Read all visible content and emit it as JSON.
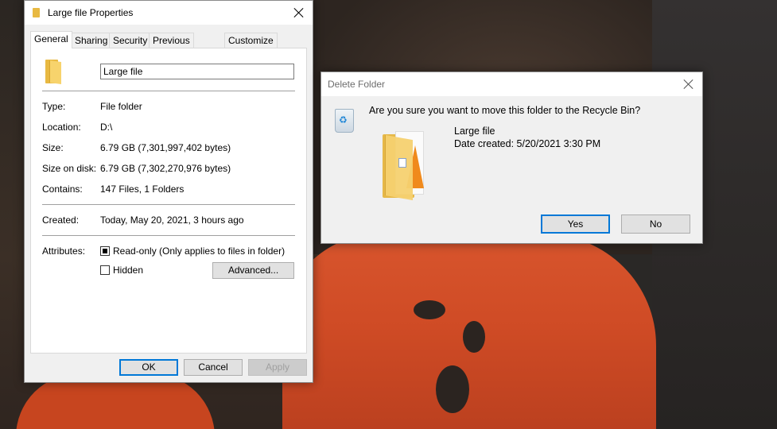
{
  "properties_dialog": {
    "title": "Large file Properties",
    "tabs": [
      {
        "label": "General",
        "active": true
      },
      {
        "label": "Sharing"
      },
      {
        "label": "Security"
      },
      {
        "label": "Previous Versions"
      },
      {
        "label": "Customize"
      }
    ],
    "name_value": "Large file",
    "rows": {
      "type": {
        "label": "Type:",
        "value": "File folder"
      },
      "location": {
        "label": "Location:",
        "value": "D:\\"
      },
      "size": {
        "label": "Size:",
        "value": "6.79 GB (7,301,997,402 bytes)"
      },
      "size_on_disk": {
        "label": "Size on disk:",
        "value": "6.79 GB (7,302,270,976 bytes)"
      },
      "contains": {
        "label": "Contains:",
        "value": "147 Files, 1 Folders"
      },
      "created": {
        "label": "Created:",
        "value": "Today, May 20, 2021, 3 hours ago"
      }
    },
    "attributes": {
      "label": "Attributes:",
      "readonly_label": "Read-only (Only applies to files in folder)",
      "readonly_state": "indeterminate",
      "hidden_label": "Hidden",
      "hidden_checked": false,
      "advanced_button": "Advanced..."
    },
    "buttons": {
      "ok": "OK",
      "cancel": "Cancel",
      "apply": "Apply"
    },
    "icons": {
      "title_icon": "folder-icon",
      "large_icon": "folder-icon"
    }
  },
  "delete_dialog": {
    "title": "Delete Folder",
    "question": "Are you sure you want to move this folder to the Recycle Bin?",
    "item_name": "Large file",
    "date_created": "Date created: 5/20/2021 3:30 PM",
    "buttons": {
      "yes": "Yes",
      "no": "No"
    },
    "icons": {
      "recycle": "recycle-bin-icon",
      "thumbnail": "folder-thumbnail-icon"
    }
  },
  "colors": {
    "focus_border": "#0078d7",
    "dialog_bg": "#f0f0f0",
    "folder_yellow": "#e8b942"
  }
}
